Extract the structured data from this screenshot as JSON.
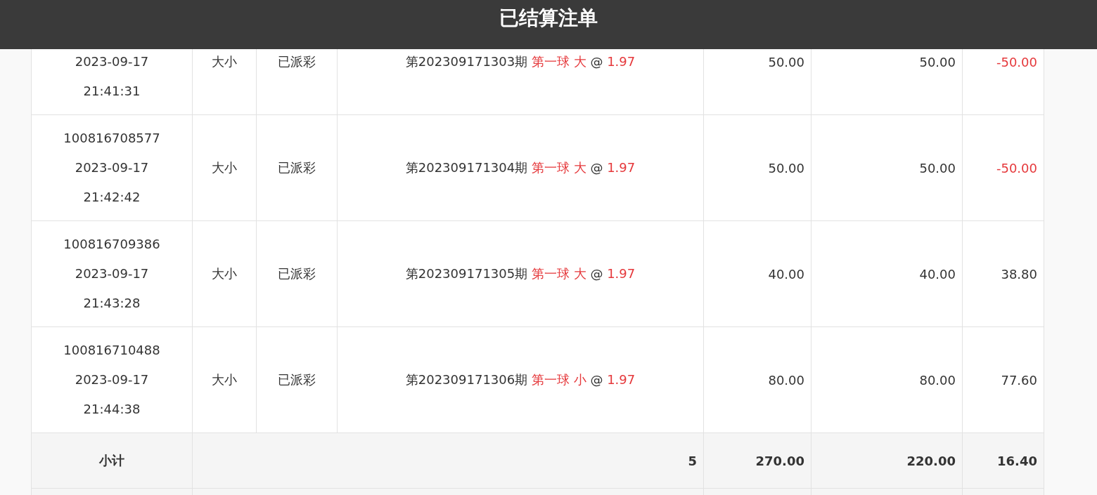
{
  "header": {
    "title": "已结算注单"
  },
  "rows": [
    {
      "lines": [
        "2023-09-17",
        "21:41:31"
      ],
      "type": "大小",
      "status": "已派彩",
      "detail": [
        {
          "text": "第202309171303期",
          "highlight": false
        },
        {
          "text": "第一球 大",
          "highlight": true
        },
        {
          "text": "@",
          "highlight": false
        },
        {
          "text": "1.97",
          "highlight": true
        }
      ],
      "stake": "50.00",
      "valid": "50.00",
      "result": "-50.00",
      "loss": true
    },
    {
      "lines": [
        "100816708577",
        "2023-09-17",
        "21:42:42"
      ],
      "type": "大小",
      "status": "已派彩",
      "detail": [
        {
          "text": "第202309171304期",
          "highlight": false
        },
        {
          "text": "第一球 大",
          "highlight": true
        },
        {
          "text": "@",
          "highlight": false
        },
        {
          "text": "1.97",
          "highlight": true
        }
      ],
      "stake": "50.00",
      "valid": "50.00",
      "result": "-50.00",
      "loss": true
    },
    {
      "lines": [
        "100816709386",
        "2023-09-17",
        "21:43:28"
      ],
      "type": "大小",
      "status": "已派彩",
      "detail": [
        {
          "text": "第202309171305期",
          "highlight": false
        },
        {
          "text": "第一球 大",
          "highlight": true
        },
        {
          "text": "@",
          "highlight": false
        },
        {
          "text": "1.97",
          "highlight": true
        }
      ],
      "stake": "40.00",
      "valid": "40.00",
      "result": "38.80",
      "loss": false
    },
    {
      "lines": [
        "100816710488",
        "2023-09-17",
        "21:44:38"
      ],
      "type": "大小",
      "status": "已派彩",
      "detail": [
        {
          "text": "第202309171306期",
          "highlight": false
        },
        {
          "text": "第一球 小",
          "highlight": true
        },
        {
          "text": "@",
          "highlight": false
        },
        {
          "text": "1.97",
          "highlight": true
        }
      ],
      "stake": "80.00",
      "valid": "80.00",
      "result": "77.60",
      "loss": false
    }
  ],
  "subtotal": {
    "label": "小计",
    "count": "5",
    "stake": "270.00",
    "valid": "220.00",
    "result": "16.40"
  }
}
